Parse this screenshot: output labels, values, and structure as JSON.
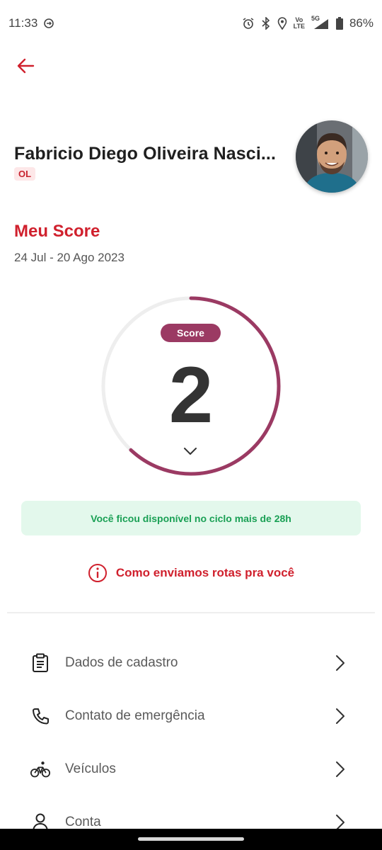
{
  "status_bar": {
    "time": "11:33",
    "battery": "86%",
    "network_top": "Vo",
    "network_bottom": "LTE",
    "signal_label": "5G",
    "icons": [
      "sync-icon",
      "alarm-icon",
      "bluetooth-icon",
      "location-icon",
      "volte-icon",
      "signal-icon",
      "battery-icon"
    ]
  },
  "header": {
    "back_icon": "arrow-left-icon"
  },
  "profile": {
    "name": "Fabricio Diego Oliveira Nasci...",
    "badge": "OL"
  },
  "score_section": {
    "title": "Meu Score",
    "period": "24 Jul - 20 Ago 2023",
    "pill_label": "Score",
    "value": "2",
    "progress_fraction": 0.62
  },
  "availability_message": "Você ficou disponível no ciclo mais de 28h",
  "info_link": "Como enviamos rotas pra você",
  "menu": [
    {
      "label": "Dados de cadastro",
      "icon": "clipboard-icon"
    },
    {
      "label": "Contato de emergência",
      "icon": "phone-icon"
    },
    {
      "label": "Veículos",
      "icon": "bicycle-icon"
    },
    {
      "label": "Conta",
      "icon": "user-icon"
    }
  ],
  "colors": {
    "accent_red": "#d0202d",
    "score_ring": "#9b3a63",
    "track": "#eeeeee",
    "success_bg": "#e3f8ec",
    "success_text": "#1aa055"
  }
}
